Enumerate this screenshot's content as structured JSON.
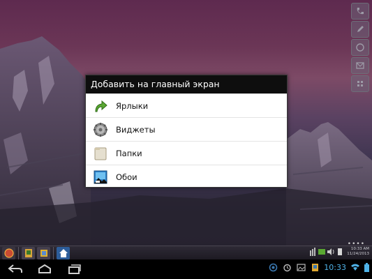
{
  "dialog": {
    "title": "Добавить на главный экран",
    "items": [
      {
        "label": "Ярлыки",
        "icon": "shortcut-arrow-icon"
      },
      {
        "label": "Виджеты",
        "icon": "gear-widgets-icon"
      },
      {
        "label": "Папки",
        "icon": "folder-icon"
      },
      {
        "label": "Обои",
        "icon": "wallpaper-picture-icon"
      }
    ]
  },
  "taskbar": {
    "clock_time": "10:33 AM",
    "clock_date": "11/24/2013"
  },
  "statusbar": {
    "time": "10:33"
  },
  "colors": {
    "dialog_title_bg": "#0e0e0e",
    "status_time": "#4fb3e8",
    "battery": "#4fb3e8"
  }
}
